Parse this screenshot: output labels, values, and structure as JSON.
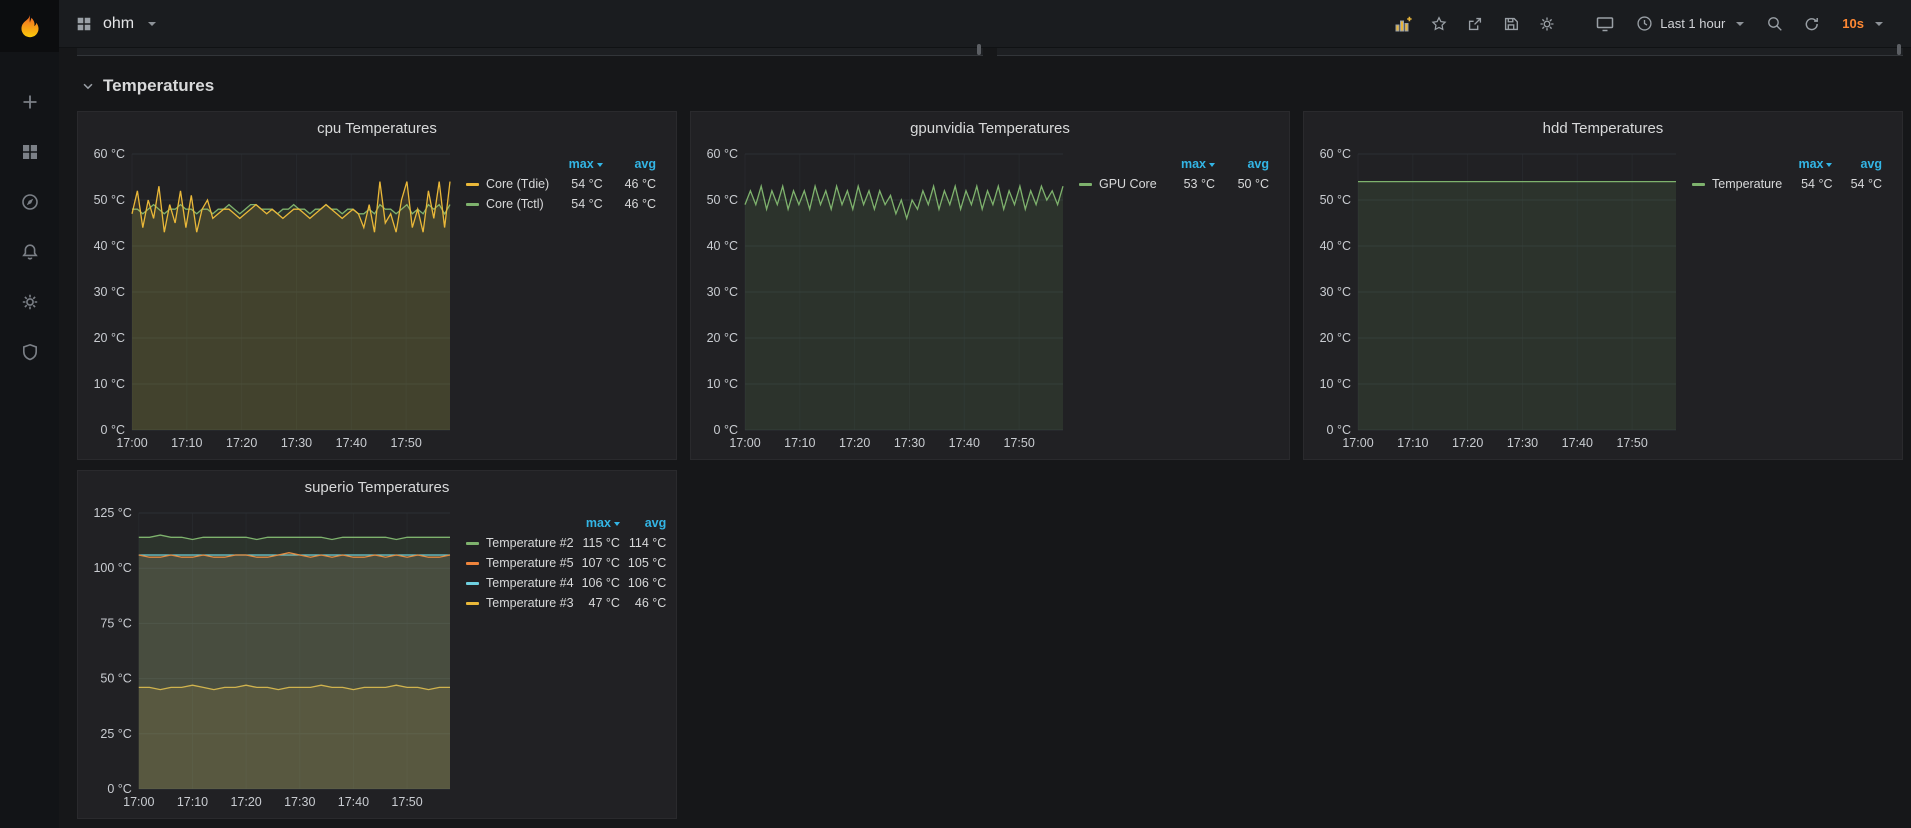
{
  "colors": {
    "yellow": "#EAB839",
    "green": "#7EB26D",
    "orange": "#EF843C",
    "cyan": "#6ED0E0",
    "legend_header_blue": "#33B5E5",
    "refresh_accent": "#FF8833",
    "grafana_orange": "#F05A28"
  },
  "navbar": {
    "dashboard_title": "ohm",
    "time_range_label": "Last 1 hour",
    "refresh_interval": "10s"
  },
  "row": {
    "title": "Temperatures"
  },
  "legend": {
    "max_label": "max",
    "avg_label": "avg"
  },
  "panels": [
    {
      "title": "cpu Temperatures",
      "series": [
        {
          "name": "Core (Tdie)",
          "max": "54 °C",
          "avg": "46 °C",
          "color": "#EAB839"
        },
        {
          "name": "Core (Tctl)",
          "max": "54 °C",
          "avg": "46 °C",
          "color": "#7EB26D"
        }
      ]
    },
    {
      "title": "gpunvidia Temperatures",
      "series": [
        {
          "name": "GPU Core",
          "max": "53 °C",
          "avg": "50 °C",
          "color": "#7EB26D"
        }
      ]
    },
    {
      "title": "hdd Temperatures",
      "series": [
        {
          "name": "Temperature",
          "max": "54 °C",
          "avg": "54 °C",
          "color": "#7EB26D"
        }
      ]
    },
    {
      "title": "superio Temperatures",
      "series": [
        {
          "name": "Temperature #2",
          "max": "115 °C",
          "avg": "114 °C",
          "color": "#7EB26D"
        },
        {
          "name": "Temperature #5",
          "max": "107 °C",
          "avg": "105 °C",
          "color": "#EF843C"
        },
        {
          "name": "Temperature #4",
          "max": "106 °C",
          "avg": "106 °C",
          "color": "#6ED0E0"
        },
        {
          "name": "Temperature #3",
          "max": "47 °C",
          "avg": "46 °C",
          "color": "#EAB839"
        }
      ]
    }
  ],
  "chart_data": [
    {
      "type": "line",
      "title": "cpu Temperatures",
      "ylim": [
        0,
        60
      ],
      "y_ticks": [
        0,
        10,
        20,
        30,
        40,
        50,
        60
      ],
      "y_tick_labels": [
        "0 °C",
        "10 °C",
        "20 °C",
        "30 °C",
        "40 °C",
        "50 °C",
        "60 °C"
      ],
      "x_tick_labels": [
        "17:00",
        "17:10",
        "17:20",
        "17:30",
        "17:40",
        "17:50"
      ],
      "x_tick_minutes": [
        0,
        10,
        20,
        30,
        40,
        50
      ],
      "x_max": 58,
      "grid": true,
      "legend_position": "right",
      "series": [
        {
          "name": "Core (Tdie)",
          "color": "#EAB839",
          "values": [
            47,
            52,
            44,
            50,
            46,
            53,
            43,
            49,
            45,
            52,
            44,
            51,
            43,
            48,
            50,
            46,
            47,
            48,
            48,
            47,
            46,
            47,
            48,
            49,
            48,
            47,
            48,
            47,
            46,
            47,
            48,
            48,
            47,
            46,
            47,
            48,
            49,
            48,
            47,
            46,
            47,
            48,
            47,
            44,
            49,
            43,
            54,
            45,
            47,
            43,
            50,
            54,
            44,
            48,
            43,
            52,
            46,
            54,
            44,
            54
          ]
        },
        {
          "name": "Core (Tctl)",
          "color": "#7EB26D",
          "values": [
            48,
            48,
            47,
            48,
            49,
            48,
            47,
            48,
            48,
            49,
            48,
            48,
            47,
            48,
            48,
            47,
            48,
            48,
            49,
            48,
            47,
            48,
            49,
            49,
            48,
            48,
            48,
            47,
            48,
            48,
            49,
            48,
            48,
            47,
            48,
            48,
            49,
            48,
            48,
            47,
            48,
            48,
            47,
            47,
            48,
            47,
            49,
            48,
            48,
            47,
            48,
            49,
            47,
            48,
            47,
            49,
            48,
            49,
            47,
            49
          ]
        }
      ]
    },
    {
      "type": "line",
      "title": "gpunvidia Temperatures",
      "ylim": [
        0,
        60
      ],
      "y_ticks": [
        0,
        10,
        20,
        30,
        40,
        50,
        60
      ],
      "y_tick_labels": [
        "0 °C",
        "10 °C",
        "20 °C",
        "30 °C",
        "40 °C",
        "50 °C",
        "60 °C"
      ],
      "x_tick_labels": [
        "17:00",
        "17:10",
        "17:20",
        "17:30",
        "17:40",
        "17:50"
      ],
      "x_tick_minutes": [
        0,
        10,
        20,
        30,
        40,
        50
      ],
      "x_max": 58,
      "grid": true,
      "legend_position": "right",
      "series": [
        {
          "name": "GPU Core",
          "color": "#7EB26D",
          "values": [
            49,
            52,
            49,
            53,
            48,
            52,
            49,
            53,
            48,
            52,
            49,
            52,
            48,
            53,
            49,
            52,
            48,
            53,
            49,
            52,
            48,
            53,
            49,
            52,
            48,
            52,
            49,
            51,
            47,
            50,
            46,
            50,
            48,
            52,
            49,
            53,
            48,
            52,
            49,
            53,
            48,
            52,
            49,
            53,
            48,
            52,
            49,
            53,
            48,
            52,
            49,
            53,
            48,
            52,
            49,
            53,
            50,
            52,
            49,
            53
          ]
        }
      ]
    },
    {
      "type": "line",
      "title": "hdd Temperatures",
      "ylim": [
        0,
        60
      ],
      "y_ticks": [
        0,
        10,
        20,
        30,
        40,
        50,
        60
      ],
      "y_tick_labels": [
        "0 °C",
        "10 °C",
        "20 °C",
        "30 °C",
        "40 °C",
        "50 °C",
        "60 °C"
      ],
      "x_tick_labels": [
        "17:00",
        "17:10",
        "17:20",
        "17:30",
        "17:40",
        "17:50"
      ],
      "x_tick_minutes": [
        0,
        10,
        20,
        30,
        40,
        50
      ],
      "x_max": 58,
      "grid": true,
      "legend_position": "right",
      "series": [
        {
          "name": "Temperature",
          "color": "#7EB26D",
          "values": [
            54,
            54,
            54,
            54,
            54,
            54,
            54,
            54,
            54,
            54,
            54,
            54
          ]
        }
      ]
    },
    {
      "type": "line",
      "title": "superio Temperatures",
      "ylim": [
        0,
        125
      ],
      "y_ticks": [
        0,
        25,
        50,
        75,
        100,
        125
      ],
      "y_tick_labels": [
        "0 °C",
        "25 °C",
        "50 °C",
        "75 °C",
        "100 °C",
        "125 °C"
      ],
      "x_tick_labels": [
        "17:00",
        "17:10",
        "17:20",
        "17:30",
        "17:40",
        "17:50"
      ],
      "x_tick_minutes": [
        0,
        10,
        20,
        30,
        40,
        50
      ],
      "x_max": 58,
      "grid": true,
      "legend_position": "right",
      "series": [
        {
          "name": "Temperature #2",
          "color": "#7EB26D",
          "values": [
            114,
            114,
            115,
            114,
            114,
            113,
            114,
            114,
            114,
            114,
            114,
            113,
            114,
            114,
            114,
            114,
            114,
            114,
            113,
            114,
            114,
            114,
            114,
            114,
            113,
            114,
            114,
            114,
            114,
            114
          ]
        },
        {
          "name": "Temperature #5",
          "color": "#EF843C",
          "values": [
            106,
            105,
            105,
            106,
            105,
            105,
            106,
            105,
            105,
            106,
            106,
            105,
            105,
            106,
            107,
            106,
            105,
            106,
            105,
            106,
            105,
            105,
            106,
            105,
            106,
            105,
            106,
            105,
            105,
            106
          ]
        },
        {
          "name": "Temperature #4",
          "color": "#6ED0E0",
          "values": [
            106,
            106,
            106,
            106,
            106,
            106,
            106,
            106,
            106,
            106,
            106,
            106,
            106,
            106,
            106,
            106,
            106,
            106,
            106,
            106,
            106,
            106,
            106,
            106,
            106,
            106,
            106,
            106,
            106,
            106
          ]
        },
        {
          "name": "Temperature #3",
          "color": "#EAB839",
          "values": [
            46,
            46,
            45,
            46,
            46,
            47,
            46,
            45,
            46,
            46,
            47,
            46,
            46,
            45,
            46,
            46,
            46,
            47,
            46,
            46,
            45,
            46,
            46,
            46,
            47,
            46,
            46,
            45,
            46,
            46
          ]
        }
      ]
    }
  ]
}
